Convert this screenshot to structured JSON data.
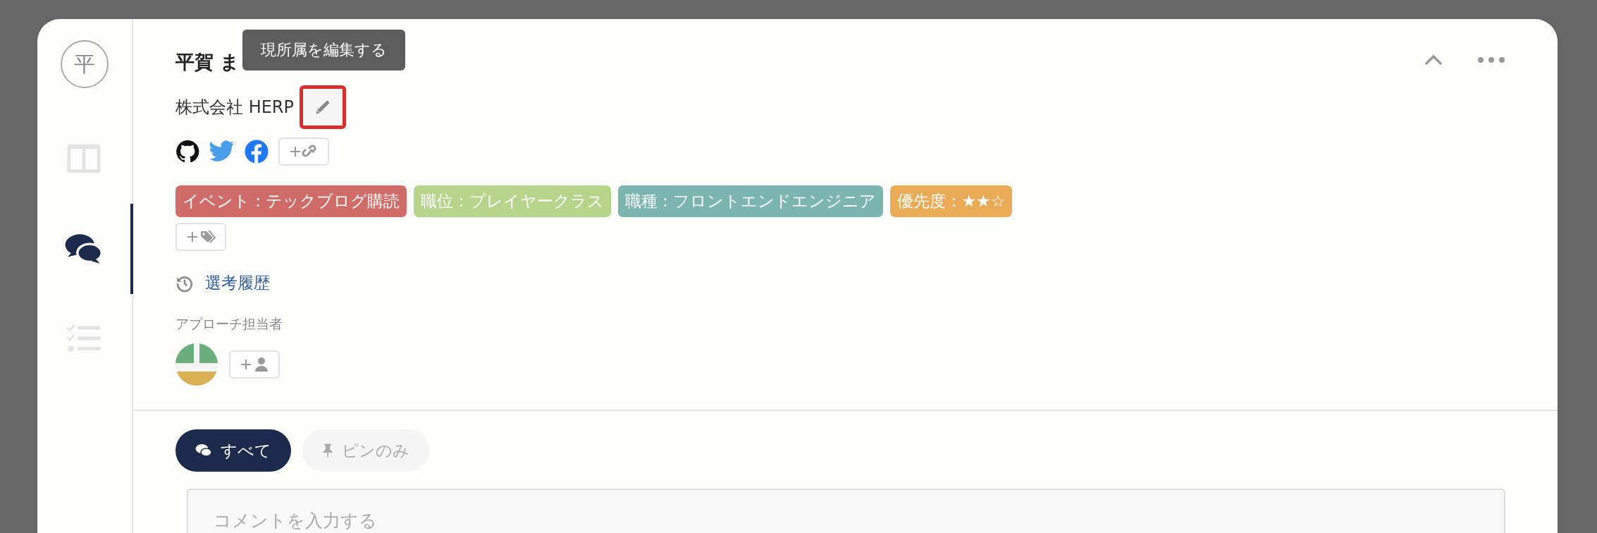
{
  "sidebar": {
    "avatar": "平",
    "items": [
      {
        "kind": "board",
        "selected": false
      },
      {
        "kind": "chat",
        "selected": true
      },
      {
        "kind": "tasks",
        "selected": false
      }
    ]
  },
  "profile": {
    "name": "平賀 ま",
    "company": "株式会社 HERP",
    "tooltip": "現所属を編集する"
  },
  "tags": [
    {
      "label": "イベント : テックブログ購読",
      "color": "#cf6c68"
    },
    {
      "label": "職位 : プレイヤークラス",
      "color": "#b7d58a"
    },
    {
      "label": "職種 : フロントエンドエンジニア",
      "color": "#7bb5ad"
    },
    {
      "label": "優先度 : ★★☆",
      "color": "#eaab57"
    }
  ],
  "history_link": "選考履歴",
  "assignee_label": "アプローチ担当者",
  "tabs": [
    {
      "label": "すべて",
      "kind": "all",
      "selected": true
    },
    {
      "label": "ピンのみ",
      "kind": "pin",
      "selected": false
    }
  ],
  "comment": {
    "placeholder": "コメントを入力する"
  }
}
